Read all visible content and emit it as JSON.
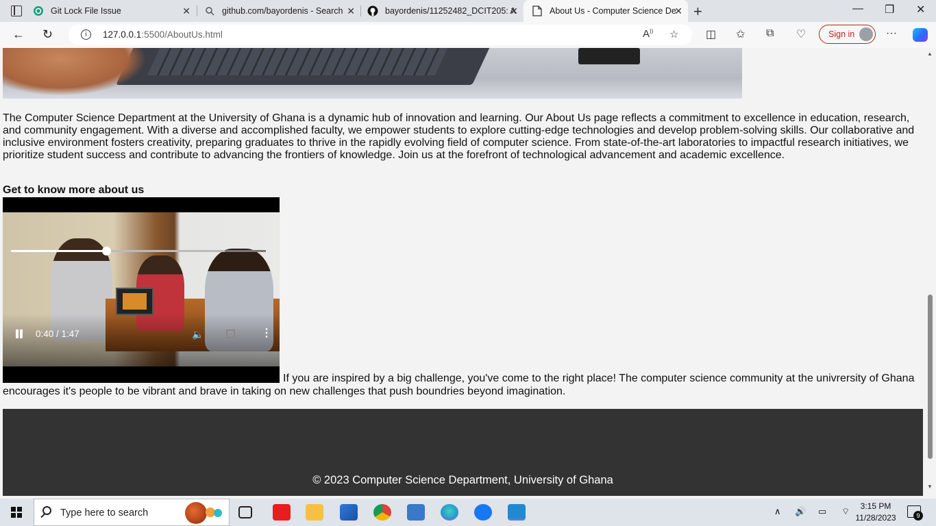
{
  "browser": {
    "tabs": [
      {
        "title": "Git Lock File Issue",
        "icon": "chatgpt-icon"
      },
      {
        "title": "github.com/bayordenis - Search",
        "icon": "search-icon"
      },
      {
        "title": "bayordenis/11252482_DCIT205: A",
        "icon": "github-icon"
      },
      {
        "title": "About Us - Computer Science De",
        "icon": "page-icon",
        "active": true
      }
    ],
    "url_host": "127.0.0.1",
    "url_rest": ":5500/AboutUs.html",
    "signin_label": "Sign in"
  },
  "page": {
    "intro": "The Computer Science Department at the University of Ghana is a dynamic hub of innovation and learning. Our About Us page reflects a commitment to excellence in education, research, and community engagement. With a diverse and accomplished faculty, we empower students to explore cutting-edge technologies and develop problem-solving skills. Our collaborative and inclusive environment fosters creativity, preparing graduates to thrive in the rapidly evolving field of computer science. From state-of-the-art laboratories to impactful research initiatives, we prioritize student success and contribute to advancing the frontiers of knowledge. Join us at the forefront of technological advancement and academic excellence.",
    "section_heading": "Get to know more about us",
    "video": {
      "current_time": "0:40",
      "duration": "1:47",
      "time_display": "0:40 / 1:47",
      "progress": 0.374
    },
    "video_text": "If you are inspired by a big challenge, you've come to the right place! The computer science community at the univrersity of Ghana encourages it's people to be vibrant and brave in taking on new challenges that push boundries beyond imagination.",
    "footer_text": "© 2023 Computer Science Department, University of Ghana"
  },
  "taskbar": {
    "search_placeholder": "Type here to search",
    "time": "3:15 PM",
    "date": "11/28/2023",
    "notification_count": "9"
  }
}
